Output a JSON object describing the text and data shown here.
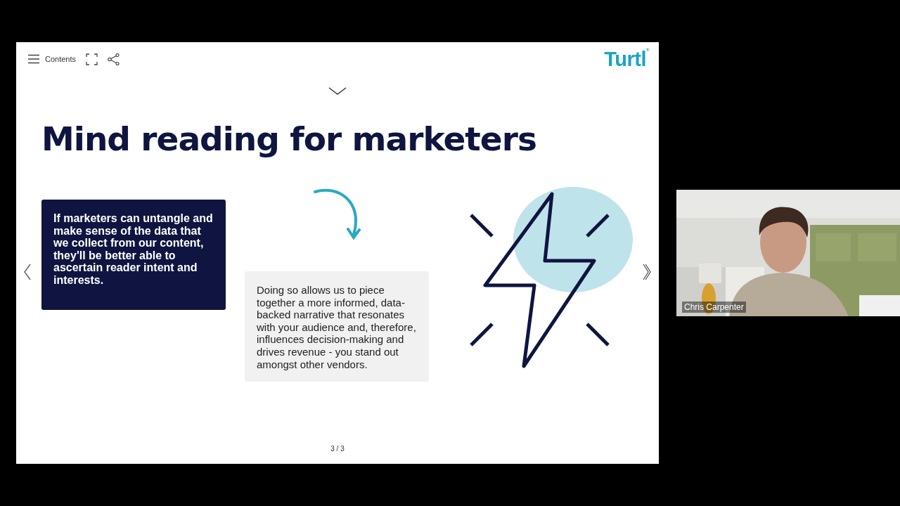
{
  "toolbar": {
    "contents_label": "Contents"
  },
  "logo": "Turtl$^{®}$",
  "title": "Mind reading for marketers",
  "cards": [
    {
      "kind": "dark",
      "text": "If marketers can untangle and make sense of the data that we collect from our content, they'll be better able to ascertain reader intent and interests."
    },
    {
      "kind": "light",
      "text": "Doing so allows us to piece together a more informed, data-backed narrative that resonates with your audience and, therefore, influences decision-making and drives revenue - you stand out amongst other vendors."
    }
  ],
  "pager": "3 / 3",
  "participant": {
    "name": "Chris Carpenter"
  }
}
